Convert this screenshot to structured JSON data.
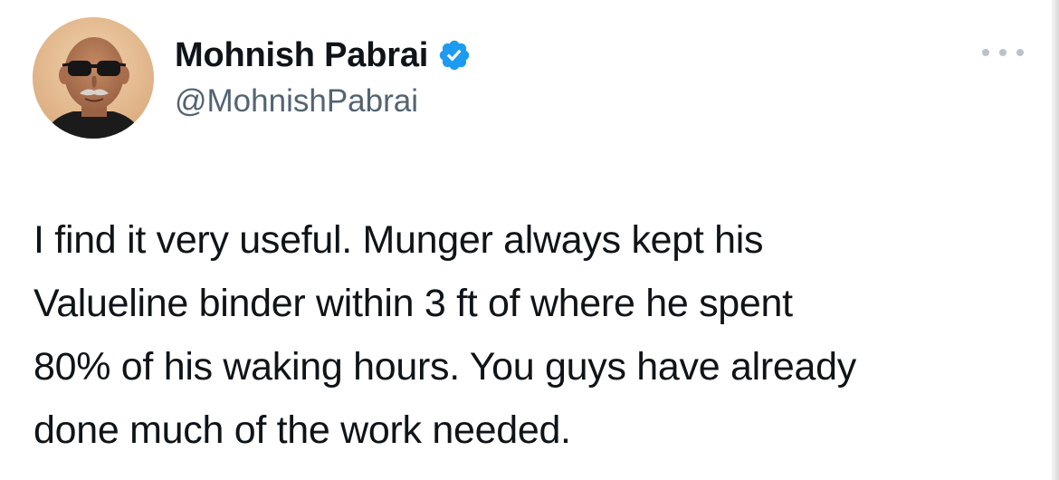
{
  "author": {
    "display_name": "Mohnish Pabrai",
    "handle": "@MohnishPabrai",
    "verified": true,
    "verified_icon": "verified-badge-icon",
    "avatar_icon": "profile-photo"
  },
  "actions": {
    "more_icon": "more-options-icon"
  },
  "tweet": {
    "lines": [
      "I find it very useful. Munger always kept his",
      "Valueline binder within 3 ft of where he spent",
      "80% of his waking hours. You guys have already",
      "done much of the work needed."
    ]
  },
  "colors": {
    "text": "#0f1419",
    "secondary": "#536471",
    "verified_blue": "#1d9bf0",
    "background": "#ffffff"
  }
}
